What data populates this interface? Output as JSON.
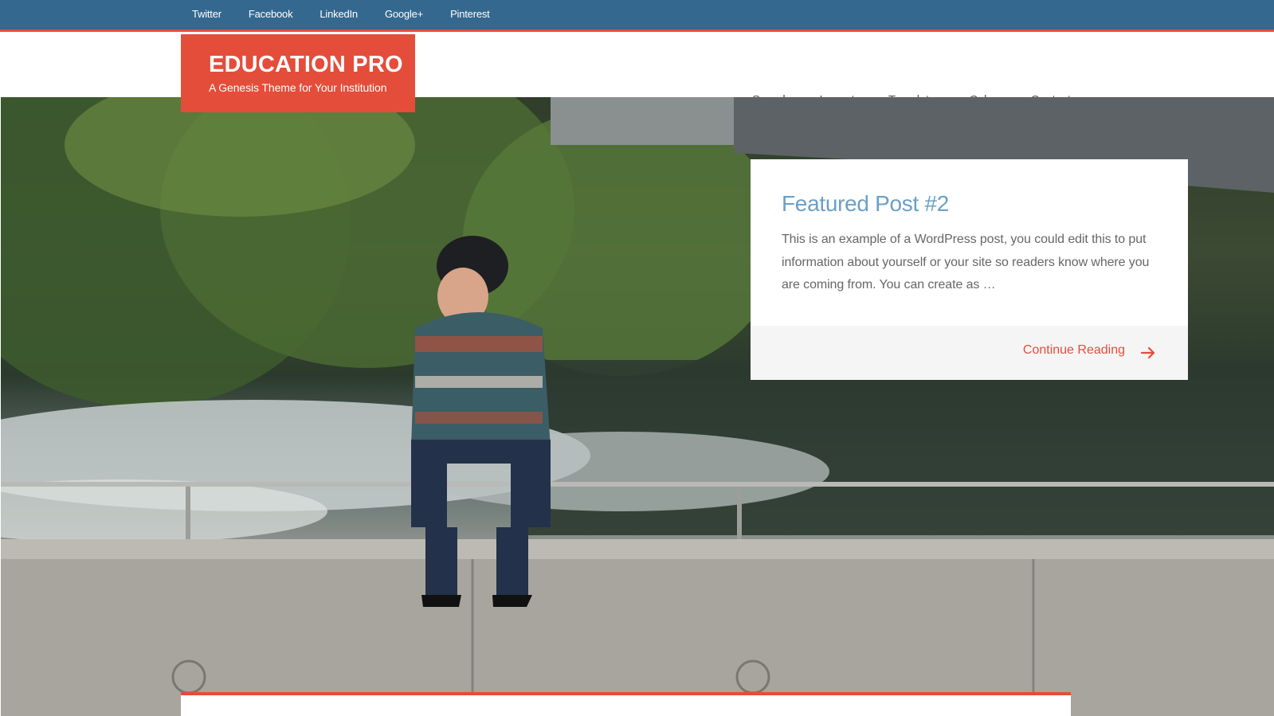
{
  "social_links": [
    "Twitter",
    "Facebook",
    "LinkedIn",
    "Google+",
    "Pinterest"
  ],
  "site": {
    "title": "EDUCATION PRO",
    "description": "A Genesis Theme for Your Institution"
  },
  "nav": [
    "Sample",
    "Layouts",
    "Templates",
    "Colors",
    "Contact"
  ],
  "featured": {
    "title": "Featured Post #2",
    "excerpt": "This is an example of a WordPress post, you could edit this to put information about yourself or your site so readers know where you are coming from. You can create as …",
    "read_more": "Continue Reading"
  },
  "hero_image": "person-sitting-on-concrete-ledge-by-river-photo",
  "icons": {
    "read_more": "arrow-right-icon"
  },
  "colors": {
    "topbar": "#34688f",
    "accent": "#e44d3a",
    "link_blue": "#6aa0c6"
  }
}
